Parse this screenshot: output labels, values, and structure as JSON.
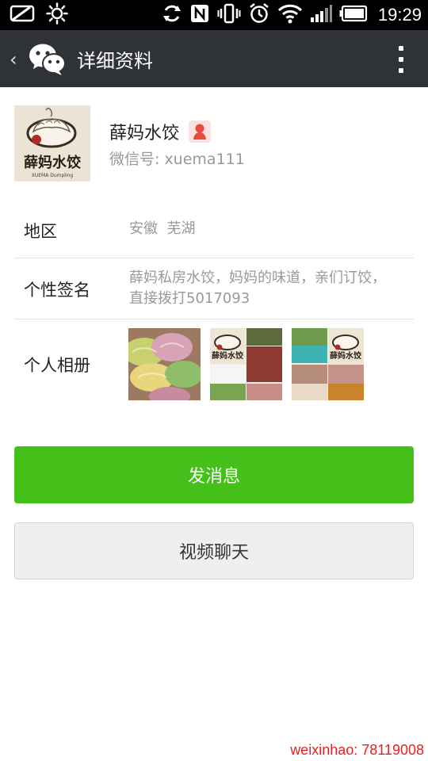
{
  "status_bar": {
    "time": "19:29",
    "left_icons": [
      "screen-off-icon",
      "brightness-icon"
    ],
    "right_icons": [
      "sync-icon",
      "nfc-icon",
      "vibrate-icon",
      "alarm-icon",
      "wifi-icon",
      "signal-icon",
      "battery-icon"
    ]
  },
  "action_bar": {
    "title": "详细资料",
    "back_glyph": "‹",
    "logo_icon": "wechat-logo-icon",
    "menu_icon": "overflow-menu-icon"
  },
  "profile": {
    "name": "薛妈水饺",
    "wechat_id": "微信号: xuema111",
    "avatar_text": "薛妈水饺",
    "avatar_subtext": "XUEMA Dumpling",
    "gender_icon": "female-icon"
  },
  "info": {
    "region_label": "地区",
    "region_value": "安徽  芜湖",
    "signature_label": "个性签名",
    "signature_value": "薛妈私房水饺，妈妈的味道，亲们订饺，直接拨打5017093",
    "album_label": "个人相册"
  },
  "buttons": {
    "send_message": "发消息",
    "video_chat": "视频聊天"
  },
  "watermark": "weixinhao: 78119008",
  "colors": {
    "status_bar": "#000000",
    "action_bar": "#2f3236",
    "primary_green": "#45c01a",
    "secondary_button": "#efefef",
    "muted_text": "#999999",
    "watermark": "#e32222"
  }
}
